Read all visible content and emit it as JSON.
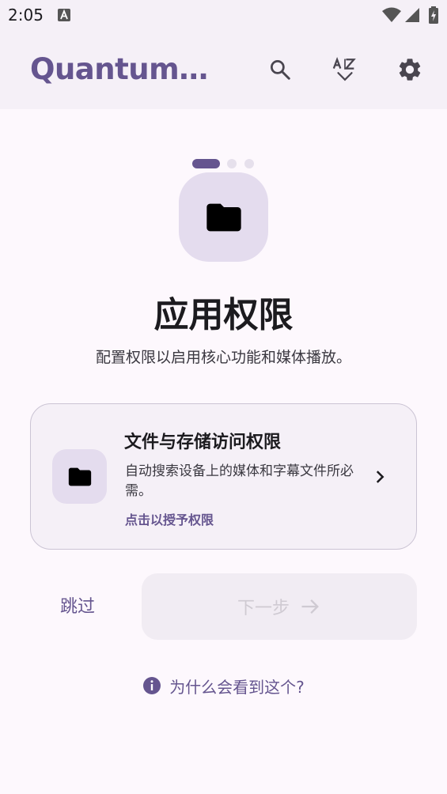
{
  "status_bar": {
    "time": "2:05",
    "notification_icon": "a-text-icon",
    "icons": [
      "wifi-icon",
      "signal-icon",
      "battery-charging-icon"
    ]
  },
  "app_bar": {
    "title": "QuantumMusic",
    "actions": [
      {
        "icon": "search-icon"
      },
      {
        "icon": "sort-az-icon"
      },
      {
        "icon": "settings-gear-icon"
      }
    ]
  },
  "onboarding": {
    "page_indicator": {
      "total": 3,
      "current": 1
    },
    "hero_icon": "folder-icon",
    "headline": "应用权限",
    "subtitle": "配置权限以启用核心功能和媒体播放。"
  },
  "permission_card": {
    "icon": "folder-icon",
    "title": "文件与存储访问权限",
    "description": "自动搜索设备上的媒体和字幕文件所必需。",
    "action_label": "点击以授予权限",
    "chevron_icon": "chevron-right-icon"
  },
  "buttons": {
    "skip_label": "跳过",
    "next_label": "下一步",
    "next_icon": "arrow-right-icon"
  },
  "info_link": {
    "icon": "info-icon",
    "label": "为什么会看到这个?"
  },
  "colors": {
    "accent": "#65558f",
    "background": "#fdf8fd",
    "surface": "#f5f0f7",
    "tonal_container": "#e4dcee",
    "disabled_text": "#cfcad2"
  }
}
